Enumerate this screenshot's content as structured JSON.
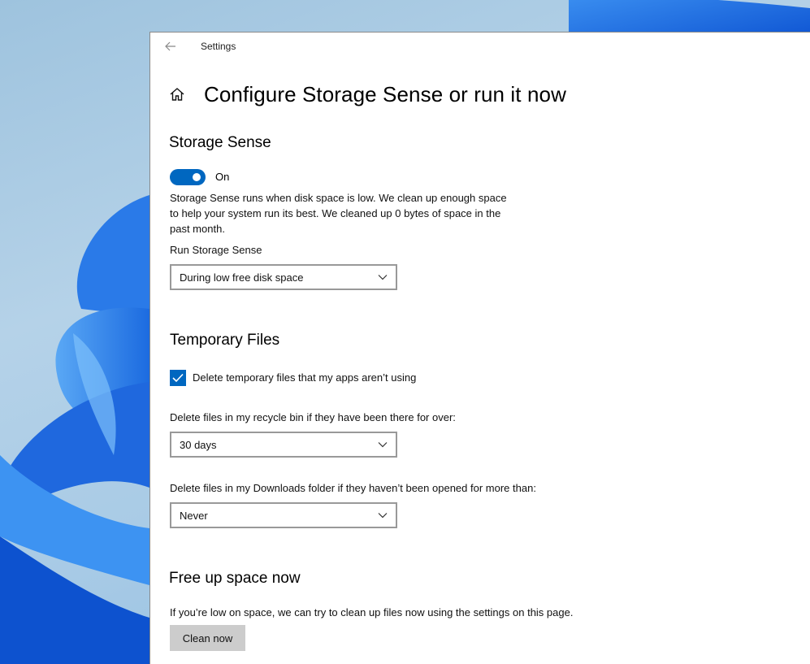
{
  "window": {
    "title": "Settings"
  },
  "page": {
    "title": "Configure Storage Sense or run it now"
  },
  "storage_sense": {
    "heading": "Storage Sense",
    "toggle_label": "On",
    "toggle_on": true,
    "description_lines": [
      "Storage Sense runs when disk space is low. We clean up enough space",
      "to help your system run its best. We cleaned up 0 bytes of space in the",
      "past month."
    ],
    "run_label": "Run Storage Sense",
    "run_value": "During low free disk space"
  },
  "temporary_files": {
    "heading": "Temporary Files",
    "checkbox_label": "Delete temporary files that my apps aren’t using",
    "checkbox_checked": true,
    "recycle_label": "Delete files in my recycle bin if they have been there for over:",
    "recycle_value": "30 days",
    "downloads_label": "Delete files in my Downloads folder if they haven’t been opened for more than:",
    "downloads_value": "Never"
  },
  "free_up": {
    "heading": "Free up space now",
    "description": "If you’re low on space, we can try to clean up files now using the settings on this page.",
    "button_label": "Clean now"
  },
  "colors": {
    "accent": "#0067c0",
    "button_bg": "#cccccc",
    "window_bg": "#ffffff"
  },
  "icons": {
    "back": "back-arrow-icon",
    "home": "home-icon",
    "chevron": "chevron-down-icon",
    "check": "checkmark-icon"
  }
}
